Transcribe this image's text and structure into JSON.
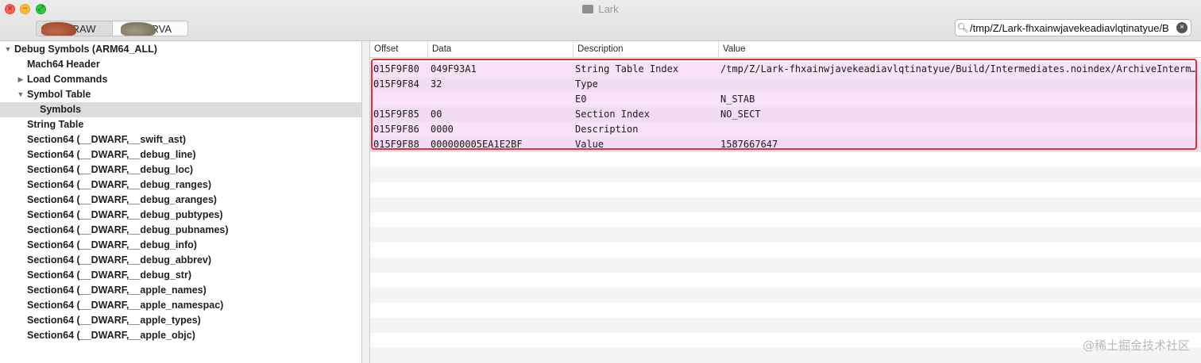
{
  "window": {
    "title": "Lark",
    "mode_buttons": [
      {
        "label": "RAW",
        "selected": true
      },
      {
        "label": "RVA",
        "selected": false
      }
    ],
    "search_value": "/tmp/Z/Lark-fhxainwjavekeadiavlqtinatyue/B"
  },
  "sidebar": {
    "items": [
      {
        "label": "Debug Symbols (ARM64_ALL)",
        "disclosure": "▼",
        "level": 0
      },
      {
        "label": "Mach64 Header",
        "disclosure": "",
        "level": 1
      },
      {
        "label": "Load Commands",
        "disclosure": "▶",
        "level": 1
      },
      {
        "label": "Symbol Table",
        "disclosure": "▼",
        "level": 1
      },
      {
        "label": "Symbols",
        "disclosure": "",
        "level": 2,
        "selected": true
      },
      {
        "label": "String Table",
        "disclosure": "",
        "level": 1
      },
      {
        "label": "Section64 (__DWARF,__swift_ast)",
        "disclosure": "",
        "level": 1
      },
      {
        "label": "Section64 (__DWARF,__debug_line)",
        "disclosure": "",
        "level": 1
      },
      {
        "label": "Section64 (__DWARF,__debug_loc)",
        "disclosure": "",
        "level": 1
      },
      {
        "label": "Section64 (__DWARF,__debug_ranges)",
        "disclosure": "",
        "level": 1
      },
      {
        "label": "Section64 (__DWARF,__debug_aranges)",
        "disclosure": "",
        "level": 1
      },
      {
        "label": "Section64 (__DWARF,__debug_pubtypes)",
        "disclosure": "",
        "level": 1
      },
      {
        "label": "Section64 (__DWARF,__debug_pubnames)",
        "disclosure": "",
        "level": 1
      },
      {
        "label": "Section64 (__DWARF,__debug_info)",
        "disclosure": "",
        "level": 1
      },
      {
        "label": "Section64 (__DWARF,__debug_abbrev)",
        "disclosure": "",
        "level": 1
      },
      {
        "label": "Section64 (__DWARF,__debug_str)",
        "disclosure": "",
        "level": 1
      },
      {
        "label": "Section64 (__DWARF,__apple_names)",
        "disclosure": "",
        "level": 1
      },
      {
        "label": "Section64 (__DWARF,__apple_namespac)",
        "disclosure": "",
        "level": 1
      },
      {
        "label": "Section64 (__DWARF,__apple_types)",
        "disclosure": "",
        "level": 1
      },
      {
        "label": "Section64 (__DWARF,__apple_objc)",
        "disclosure": "",
        "level": 1
      }
    ]
  },
  "table": {
    "columns": [
      "Offset",
      "Data",
      "Description",
      "Value"
    ],
    "rows": [
      [
        "015F9F80",
        "049F93A1",
        "String Table Index",
        "/tmp/Z/Lark-fhxainwjavekeadiavlqtinatyue/Build/Intermediates.noindex/ArchiveInterm…"
      ],
      [
        "015F9F84",
        "32",
        "Type",
        ""
      ],
      [
        "",
        "",
        "E0",
        "N_STAB"
      ],
      [
        "015F9F85",
        "00",
        "Section Index",
        "NO_SECT"
      ],
      [
        "015F9F86",
        "0000",
        "Description",
        ""
      ],
      [
        "015F9F88",
        "000000005EA1E2BF",
        "Value",
        "1587667647"
      ]
    ]
  },
  "watermark": "@稀土掘金技术社区",
  "colors": {
    "highlight_row": "#f9e2f9",
    "annotation_box": "#e0322f",
    "selected_sidebar": "#dcdcdc"
  }
}
